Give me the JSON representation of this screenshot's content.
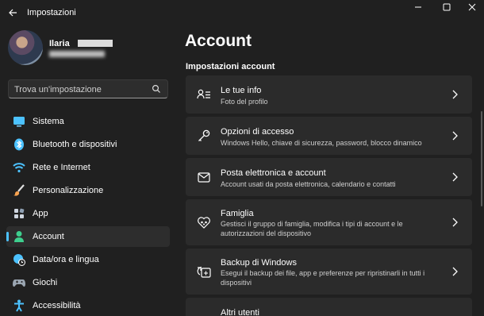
{
  "window": {
    "title": "Impostazioni",
    "back_icon": "back-arrow-icon",
    "minimize": "–",
    "maximize": "□",
    "close": "✕"
  },
  "profile": {
    "name": "Ilaria"
  },
  "search": {
    "placeholder": "Trova un'impostazione"
  },
  "sidebar": {
    "items": [
      {
        "label": "Sistema",
        "icon": "system-monitor-icon",
        "color": "#4cc2ff"
      },
      {
        "label": "Bluetooth e dispositivi",
        "icon": "bluetooth-icon",
        "color": "#4cc2ff"
      },
      {
        "label": "Rete e Internet",
        "icon": "wifi-icon",
        "color": "#4cc2ff"
      },
      {
        "label": "Personalizzazione",
        "icon": "paintbrush-icon",
        "color": "#f7a24f"
      },
      {
        "label": "App",
        "icon": "apps-icon",
        "color": "#cfd6e0"
      },
      {
        "label": "Account",
        "icon": "account-person-icon",
        "color": "#3ecf8e",
        "selected": true
      },
      {
        "label": "Data/ora e lingua",
        "icon": "globe-clock-icon",
        "color": "#4cc2ff"
      },
      {
        "label": "Giochi",
        "icon": "gamepad-icon",
        "color": "#9aa5b1"
      },
      {
        "label": "Accessibilità",
        "icon": "accessibility-icon",
        "color": "#4cc2ff"
      }
    ]
  },
  "main": {
    "title": "Account",
    "section_title": "Impostazioni account",
    "cards": [
      {
        "title": "Le tue info",
        "desc": "Foto del profilo",
        "icon": "person-info-icon"
      },
      {
        "title": "Opzioni di accesso",
        "desc": "Windows Hello, chiave di sicurezza, password, blocco dinamico",
        "icon": "key-icon"
      },
      {
        "title": "Posta elettronica e account",
        "desc": "Account usati da posta elettronica, calendario e contatti",
        "icon": "mail-icon"
      },
      {
        "title": "Famiglia",
        "desc": "Gestisci il gruppo di famiglia, modifica i tipi di account e le autorizzazioni del dispositivo",
        "icon": "family-heart-icon"
      },
      {
        "title": "Backup di Windows",
        "desc": "Esegui il backup dei file, app e preferenze per ripristinarli in tutti i dispositivi",
        "icon": "backup-icon"
      },
      {
        "title": "Altri utenti",
        "desc": "",
        "icon": "other-users-icon"
      }
    ]
  },
  "colors": {
    "background": "#202020",
    "card": "#2b2b2b",
    "accent": "#4cc2ff"
  }
}
